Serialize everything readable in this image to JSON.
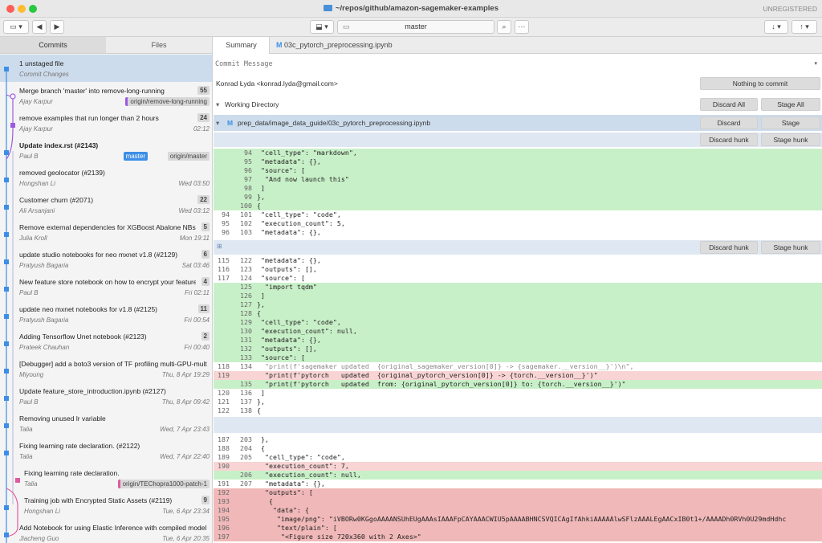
{
  "window": {
    "title": "~/repos/github/amazon-sagemaker-examples",
    "registration": "UNREGISTERED"
  },
  "toolbar": {
    "branch": "master"
  },
  "left_tabs": {
    "commits": "Commits",
    "files": "Files"
  },
  "commits": [
    {
      "title": "1 unstaged file",
      "author": "Commit Changes",
      "date": "",
      "count": "",
      "tags": []
    },
    {
      "title": "Merge branch 'master' into remove-long-running",
      "author": "Ajay Karpur",
      "date": "",
      "count": "55",
      "tags": [
        "origin/remove-long-running"
      ]
    },
    {
      "title": "remove examples that run longer than 2 hours",
      "author": "Ajay Karpur",
      "date": "02:12",
      "count": "24",
      "tags": []
    },
    {
      "title": "Update index.rst (#2143)",
      "author": "Paul B",
      "date": "",
      "count": "",
      "tags": [
        "master",
        "origin/master"
      ]
    },
    {
      "title": "removed geolocator (#2139)",
      "author": "Hongshan Li",
      "date": "Wed 03:50",
      "count": "",
      "tags": []
    },
    {
      "title": "Customer churn (#2071)",
      "author": "Ali Arsanjani",
      "date": "Wed 03:12",
      "count": "22",
      "tags": []
    },
    {
      "title": "Remove external dependencies for XGBoost Abalone NBs (#",
      "author": "Julia Kroll",
      "date": "Mon 19:11",
      "count": "5",
      "tags": []
    },
    {
      "title": "update studio notebooks for neo mxnet v1.8 (#2129)",
      "author": "Pratyush Bagaria",
      "date": "Sat 03:46",
      "count": "6",
      "tags": []
    },
    {
      "title": "New feature store notebook on how to encrypt your feature",
      "author": "Paul B",
      "date": "Fri 02:11",
      "count": "4",
      "tags": []
    },
    {
      "title": "update neo mxnet notebooks for v1.8 (#2125)",
      "author": "Pratyush Bagaria",
      "date": "Fri 00:54",
      "count": "11",
      "tags": []
    },
    {
      "title": "Adding Tensorflow Unet notebook (#2123)",
      "author": "Prateek Chauhan",
      "date": "Fri 00:40",
      "count": "2",
      "tags": []
    },
    {
      "title": "[Debugger] add a boto3 version of TF profiling multi-GPU-mult",
      "author": "Miyoung",
      "date": "Thu, 8 Apr 19:29",
      "count": "",
      "tags": []
    },
    {
      "title": "Update feature_store_introduction.ipynb (#2127)",
      "author": "Paul B",
      "date": "Thu, 8 Apr 09:42",
      "count": "",
      "tags": []
    },
    {
      "title": "Removing unused lr variable",
      "author": "Talia",
      "date": "Wed, 7 Apr 23:43",
      "count": "",
      "tags": []
    },
    {
      "title": "Fixing learning rate declaration. (#2122)",
      "author": "Talia",
      "date": "Wed, 7 Apr 22:40",
      "count": "",
      "tags": []
    },
    {
      "title": "Fixing learning rate declaration.",
      "author": "Talia",
      "date": "",
      "count": "",
      "tags": [
        "origin/TEChopra1000-patch-1"
      ]
    },
    {
      "title": "Training job with Encrypted Static Assets (#2119)",
      "author": "Hongshan Li",
      "date": "Tue, 6 Apr 23:34",
      "count": "9",
      "tags": []
    },
    {
      "title": "Add Notebook for using Elastic Inference with compiled model or",
      "author": "Jiacheng Guo",
      "date": "Tue, 6 Apr 20:35",
      "count": "",
      "tags": []
    }
  ],
  "right_tabs": {
    "summary": "Summary",
    "file_badge": "M",
    "file": "03c_pytorch_preprocessing.ipynb"
  },
  "commit_message": {
    "placeholder": "Commit Message",
    "author": "Konrad Łyda <konrad.lyda@gmail.com>",
    "button": "Nothing to commit"
  },
  "working_directory": {
    "label": "Working Directory",
    "discard_all": "Discard All",
    "stage_all": "Stage All"
  },
  "file_row": {
    "badge": "M",
    "path": "prep_data/image_data_guide/03c_pytorch_preprocessing.ipynb",
    "discard": "Discard",
    "stage": "Stage"
  },
  "hunk_buttons": {
    "discard": "Discard hunk",
    "stage": "Stage hunk"
  },
  "hunk1": [
    {
      "o": "",
      "n": "94",
      "t": " \"cell_type\": \"markdown\",",
      "k": "add"
    },
    {
      "o": "",
      "n": "95",
      "t": " \"metadata\": {},",
      "k": "add"
    },
    {
      "o": "",
      "n": "96",
      "t": " \"source\": [",
      "k": "add"
    },
    {
      "o": "",
      "n": "97",
      "t": "  \"And now launch this\"",
      "k": "add"
    },
    {
      "o": "",
      "n": "98",
      "t": " ]",
      "k": "add"
    },
    {
      "o": "",
      "n": "99",
      "t": "},",
      "k": "add"
    },
    {
      "o": "",
      "n": "100",
      "t": "{",
      "k": "add"
    },
    {
      "o": "94",
      "n": "101",
      "t": " \"cell_type\": \"code\",",
      "k": "ctx"
    },
    {
      "o": "95",
      "n": "102",
      "t": " \"execution_count\": 5,",
      "k": "ctx"
    },
    {
      "o": "96",
      "n": "103",
      "t": " \"metadata\": {},",
      "k": "ctx"
    }
  ],
  "hunk2": [
    {
      "o": "115",
      "n": "122",
      "t": " \"metadata\": {},",
      "k": "ctx"
    },
    {
      "o": "116",
      "n": "123",
      "t": " \"outputs\": [],",
      "k": "ctx"
    },
    {
      "o": "117",
      "n": "124",
      "t": " \"source\": [",
      "k": "ctx"
    },
    {
      "o": "",
      "n": "125",
      "t": "  \"import tqdm\"",
      "k": "add"
    },
    {
      "o": "",
      "n": "126",
      "t": " ]",
      "k": "add"
    },
    {
      "o": "",
      "n": "127",
      "t": "},",
      "k": "add"
    },
    {
      "o": "",
      "n": "128",
      "t": "{",
      "k": "add"
    },
    {
      "o": "",
      "n": "129",
      "t": " \"cell_type\": \"code\",",
      "k": "add"
    },
    {
      "o": "",
      "n": "130",
      "t": " \"execution_count\": null,",
      "k": "add"
    },
    {
      "o": "",
      "n": "131",
      "t": " \"metadata\": {},",
      "k": "add"
    },
    {
      "o": "",
      "n": "132",
      "t": " \"outputs\": [],",
      "k": "add"
    },
    {
      "o": "",
      "n": "133",
      "t": " \"source\": [",
      "k": "add"
    },
    {
      "o": "118",
      "n": "134",
      "t": "  \"print(f'sagemaker updated  {original_sagemaker_version[0]} -> {sagemaker.__version__}')\\n\",",
      "k": "dim"
    },
    {
      "o": "119",
      "n": "",
      "t": "  \"print(f'pytorch   updated  {original_pytorch_version[0]} -> {torch.__version__}')\"",
      "k": "del"
    },
    {
      "o": "",
      "n": "135",
      "t": "  \"print(f'pytorch   updated  from: {original_pytorch_version[0]} to: {torch.__version__}')\"",
      "k": "add"
    },
    {
      "o": "120",
      "n": "136",
      "t": " ]",
      "k": "ctx"
    },
    {
      "o": "121",
      "n": "137",
      "t": "},",
      "k": "ctx"
    },
    {
      "o": "122",
      "n": "138",
      "t": "{",
      "k": "ctx"
    }
  ],
  "hunk3": [
    {
      "o": "187",
      "n": "203",
      "t": " },",
      "k": "ctx"
    },
    {
      "o": "188",
      "n": "204",
      "t": " {",
      "k": "ctx"
    },
    {
      "o": "189",
      "n": "205",
      "t": "  \"cell_type\": \"code\",",
      "k": "ctx"
    },
    {
      "o": "190",
      "n": "",
      "t": "  \"execution_count\": 7,",
      "k": "del"
    },
    {
      "o": "",
      "n": "206",
      "t": "  \"execution_count\": null,",
      "k": "add"
    },
    {
      "o": "191",
      "n": "207",
      "t": "  \"metadata\": {},",
      "k": "ctx"
    },
    {
      "o": "192",
      "n": "",
      "t": "  \"outputs\": [",
      "k": "hdel"
    },
    {
      "o": "193",
      "n": "",
      "t": "   {",
      "k": "hdel"
    },
    {
      "o": "194",
      "n": "",
      "t": "    \"data\": {",
      "k": "hdel"
    },
    {
      "o": "195",
      "n": "",
      "t": "     \"image/png\": \"iVBORw0KGgoAAAANSUhEUgAAAsIAAAFpCAYAAACWIU5pAAAABHNCSVQICAgIfAhkiAAAAAlwSFlzAAALEgAACxIB0t1+/AAAADh0RVh0U29mdHdhc",
      "k": "hdel"
    },
    {
      "o": "196",
      "n": "",
      "t": "     \"text/plain\": [",
      "k": "hdel"
    },
    {
      "o": "197",
      "n": "",
      "t": "      \"<Figure size 720x360 with 2 Axes>\"",
      "k": "hdel"
    }
  ]
}
